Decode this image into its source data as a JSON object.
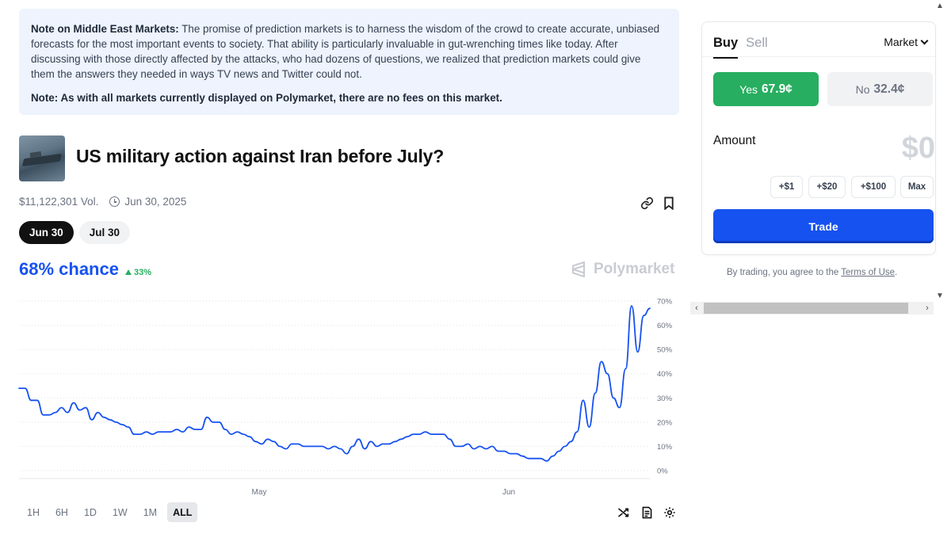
{
  "note": {
    "bold_1": "Note on Middle East Markets:",
    "text_1": " The promise of prediction markets is to harness the wisdom of the crowd to create accurate, unbiased forecasts for the most important events to society. That ability is particularly invaluable in gut-wrenching times like today. After discussing with those directly affected by the attacks, who had dozens of questions, we realized that prediction markets could give them the answers they needed in ways TV news and Twitter could not.",
    "bold_2": "Note: As with all markets currently displayed on Polymarket, there are no fees on this market."
  },
  "market": {
    "title": "US military action against Iran before July?",
    "volume": "$11,122,301 Vol.",
    "end_date": "Jun 30, 2025",
    "date_tabs": [
      {
        "label": "Jun 30",
        "active": true
      },
      {
        "label": "Jul 30",
        "active": false
      }
    ],
    "chance": "68% chance",
    "delta": "33%",
    "watermark": "Polymarket"
  },
  "chart_data": {
    "type": "line",
    "title": "",
    "xlabel": "",
    "ylabel": "",
    "x_tick_labels": [
      "May",
      "Jun"
    ],
    "y_tick_labels": [
      "0%",
      "10%",
      "20%",
      "30%",
      "40%",
      "50%",
      "60%",
      "70%"
    ],
    "ylim": [
      0,
      70
    ],
    "grid": true,
    "series": [
      {
        "color": "#1652f0",
        "values": [
          34,
          34,
          29,
          29,
          23,
          23,
          24,
          26,
          24,
          28,
          25,
          26,
          21,
          24,
          22,
          21,
          20,
          19,
          18,
          15,
          15,
          16,
          15,
          16,
          16,
          16,
          17,
          16,
          18,
          17,
          17,
          22,
          20,
          20,
          17,
          15,
          16,
          15,
          14,
          12,
          11,
          13,
          12,
          10,
          9,
          11,
          11,
          10,
          10,
          10,
          10,
          9,
          10,
          9,
          7,
          10,
          13,
          9,
          12,
          10,
          11,
          11,
          12,
          13,
          14,
          15,
          15,
          16,
          15,
          15,
          15,
          13,
          10,
          10,
          11,
          9,
          10,
          9,
          10,
          8,
          8,
          7,
          7,
          6,
          5,
          5,
          5,
          4,
          6,
          8,
          10,
          12,
          16,
          29,
          18,
          32,
          45,
          40,
          30,
          26,
          42,
          68,
          49,
          64,
          67
        ]
      }
    ]
  },
  "range_tabs": [
    "1H",
    "6H",
    "1D",
    "1W",
    "1M",
    "ALL"
  ],
  "range_active": "ALL",
  "panel": {
    "buy": "Buy",
    "sell": "Sell",
    "order_type": "Market",
    "yes_label": "Yes",
    "yes_price": "67.9¢",
    "no_label": "No",
    "no_price": "32.4¢",
    "amount_label": "Amount",
    "amount_value": "$0",
    "quick_amounts": [
      "+$1",
      "+$20",
      "+$100",
      "Max"
    ],
    "trade": "Trade"
  },
  "terms": {
    "prefix": "By trading, you agree to the ",
    "link": "Terms of Use",
    "suffix": "."
  },
  "colors": {
    "accent": "#1652f0",
    "positive": "#27ae60",
    "note_bg": "#eef3fd"
  }
}
